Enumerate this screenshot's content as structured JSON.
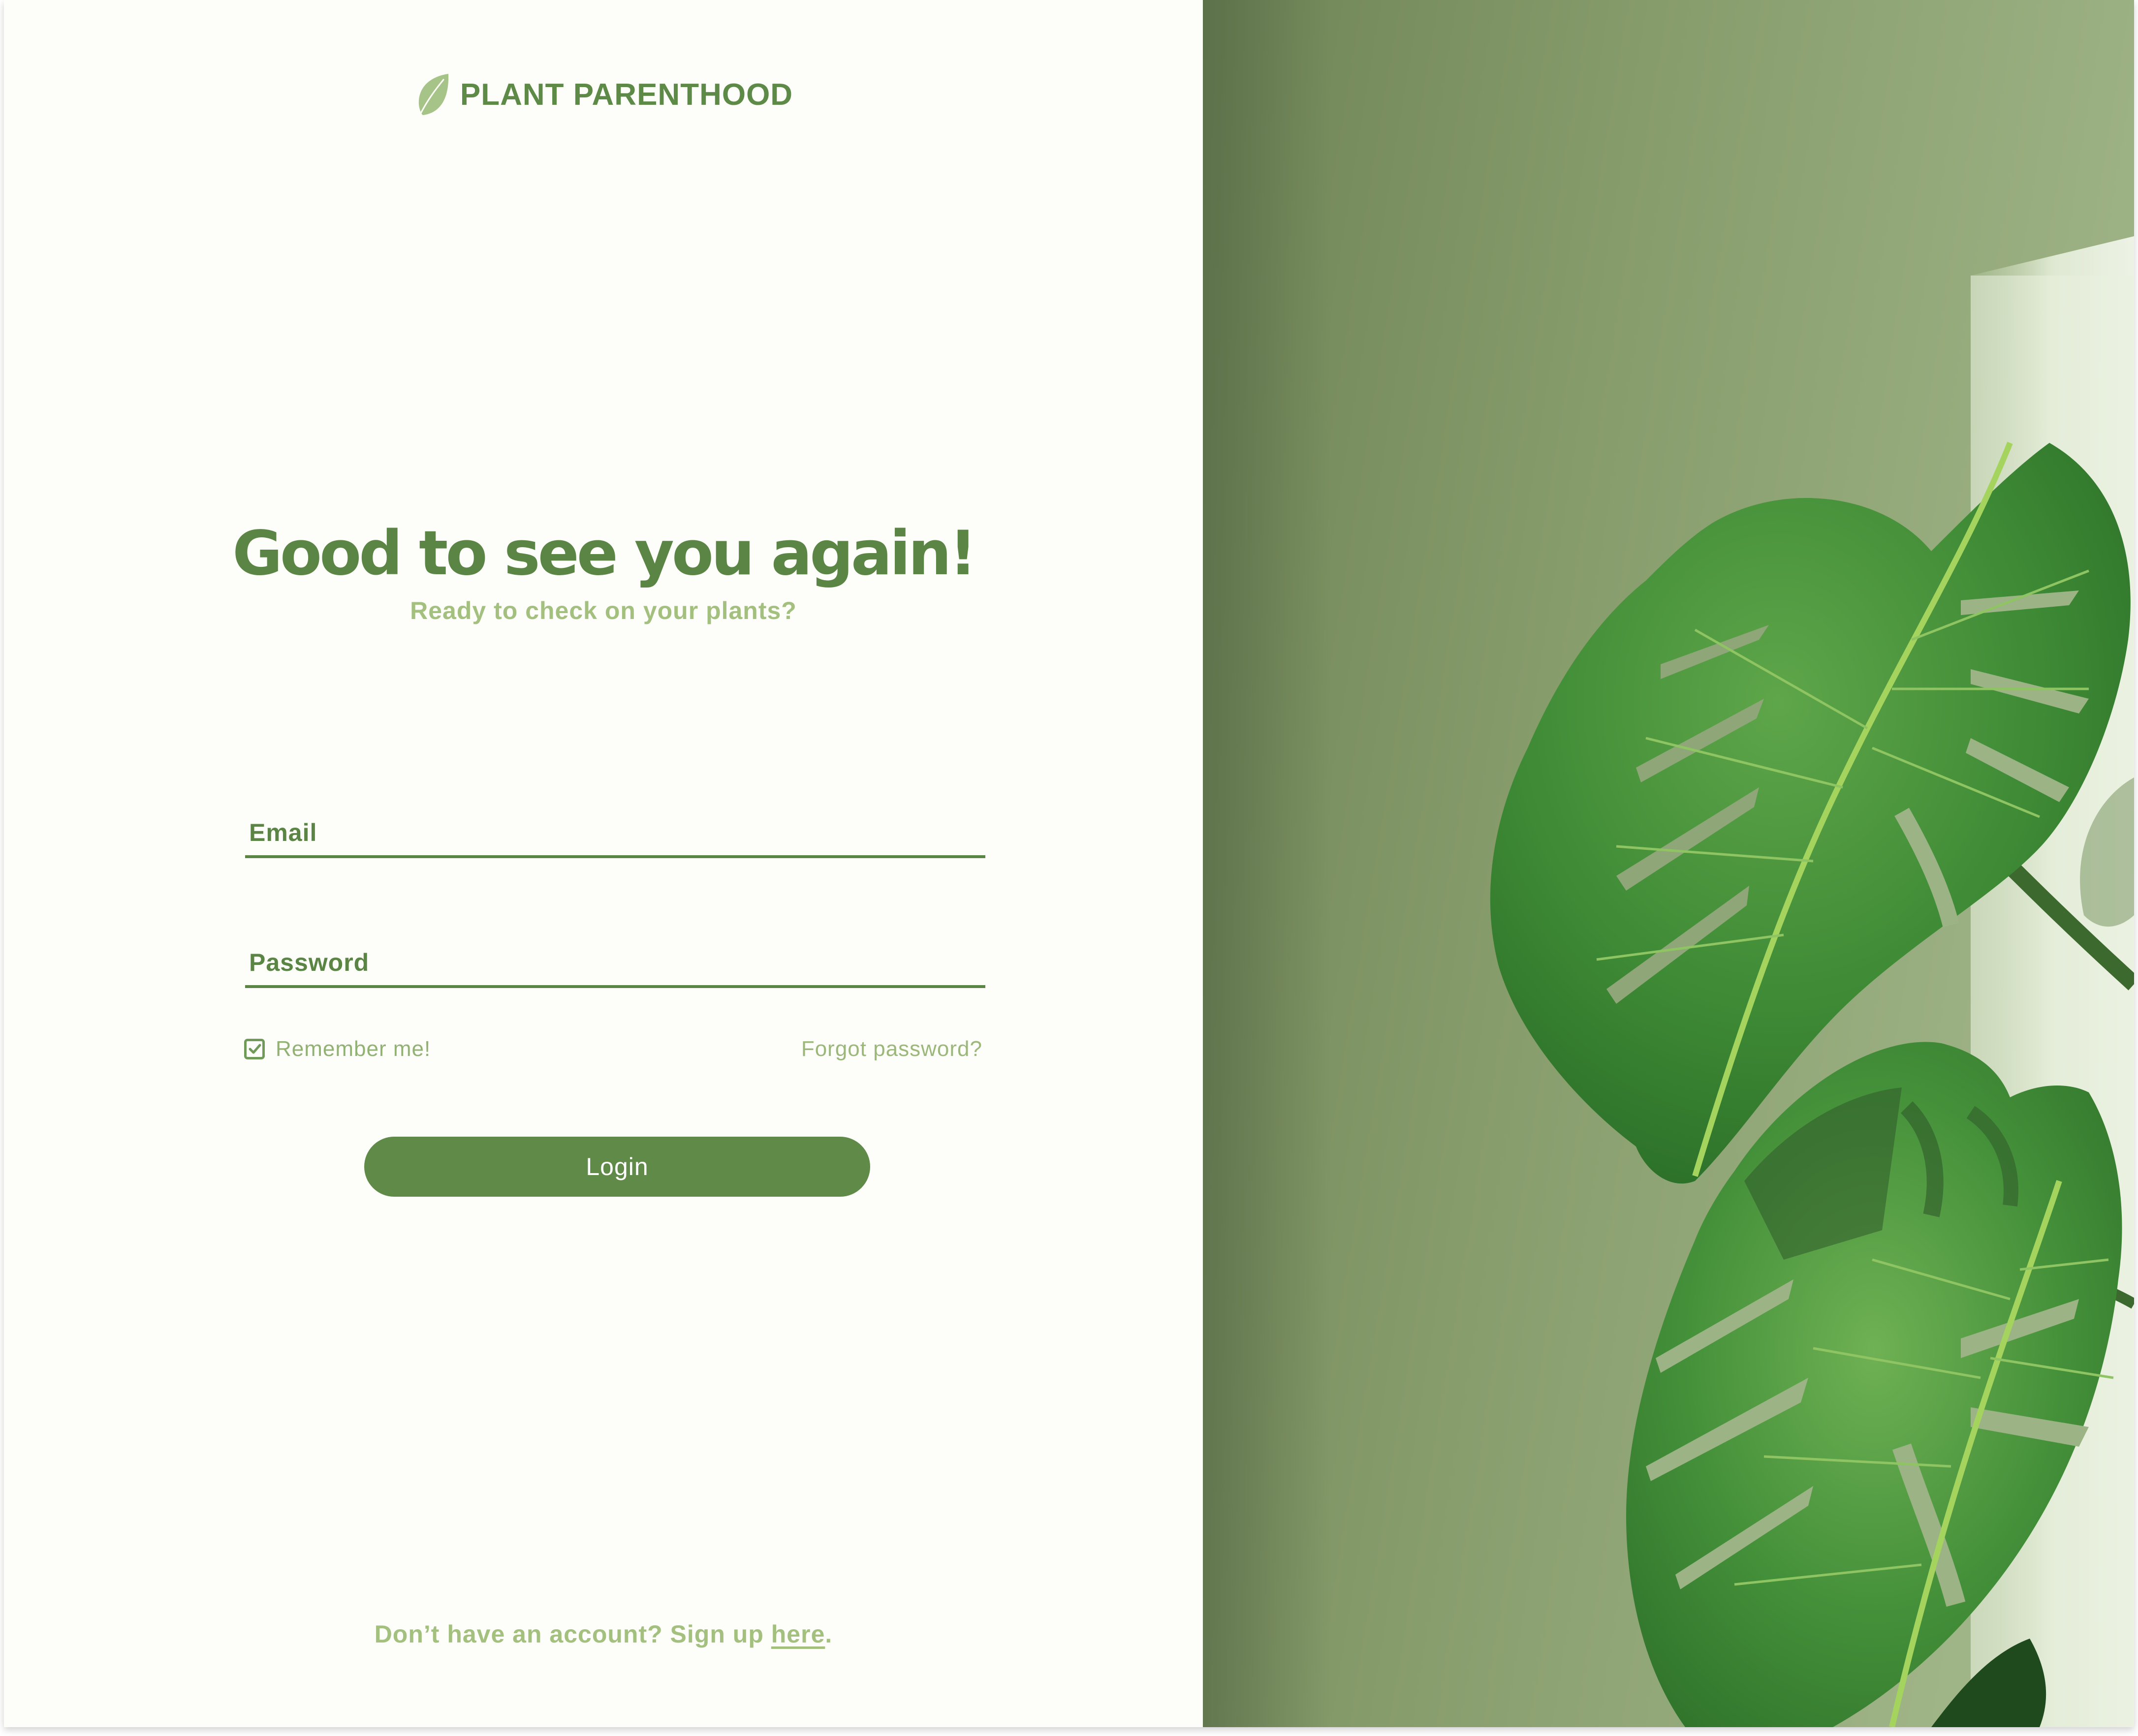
{
  "brand": {
    "name": "PLANT PARENTHOOD",
    "logo_icon": "leaf-icon"
  },
  "login": {
    "heading": "Good to see you again!",
    "subheading": "Ready to check on your plants?",
    "email_label": "Email",
    "email_value": "",
    "password_label": "Password",
    "password_value": "",
    "remember_label": "Remember me!",
    "remember_checked": true,
    "forgot_label": "Forgot password?",
    "login_button": "Login"
  },
  "footer": {
    "prefix": "Don’t have an account? Sign up ",
    "link_label": "here",
    "suffix": "."
  },
  "hero": {
    "subject": "monstera-plant-photo"
  },
  "colors": {
    "primary": "#5b8544",
    "light": "#a4c07f",
    "background": "#fdfdf9",
    "button": "#5f8a47"
  }
}
